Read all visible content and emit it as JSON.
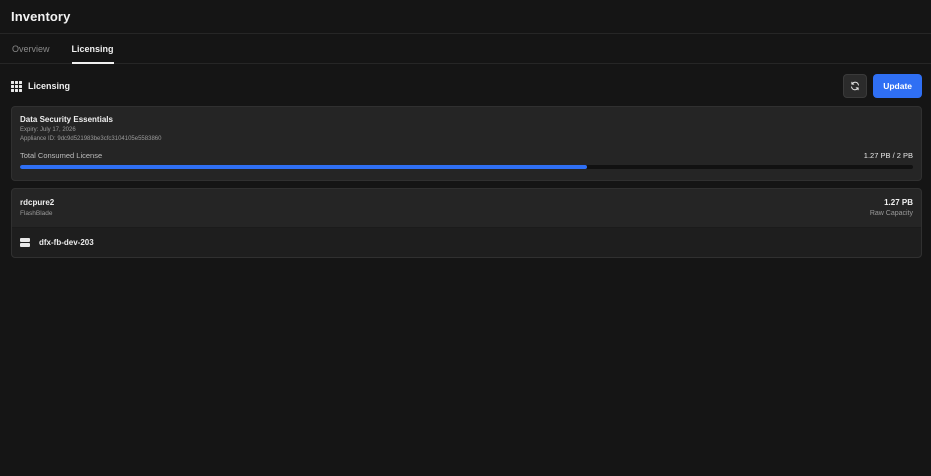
{
  "header": {
    "title": "Inventory"
  },
  "tabs": [
    {
      "label": "Overview",
      "active": false
    },
    {
      "label": "Licensing",
      "active": true
    }
  ],
  "section": {
    "icon": "grid-icon",
    "title": "Licensing",
    "refresh_icon": "refresh-icon",
    "update_label": "Update"
  },
  "license": {
    "name": "Data Security Essentials",
    "expiry": "Expiry: July 17, 2026",
    "appliance_id": "Appliance ID: 9dc9d521983be3cfc3104105e5583860",
    "consumed_label": "Total Consumed License",
    "consumed_value": "1.27 PB / 2 PB",
    "consumed_fraction": 0.635
  },
  "device": {
    "name": "rdcpure2",
    "type": "FlashBlade",
    "capacity": "1.27 PB",
    "capacity_label": "Raw Capacity",
    "host_icon": "server-icon",
    "host": "dfx-fb-dev-203"
  },
  "colors": {
    "background": "#151515",
    "card": "#252525",
    "accent": "#2f6ff4"
  }
}
